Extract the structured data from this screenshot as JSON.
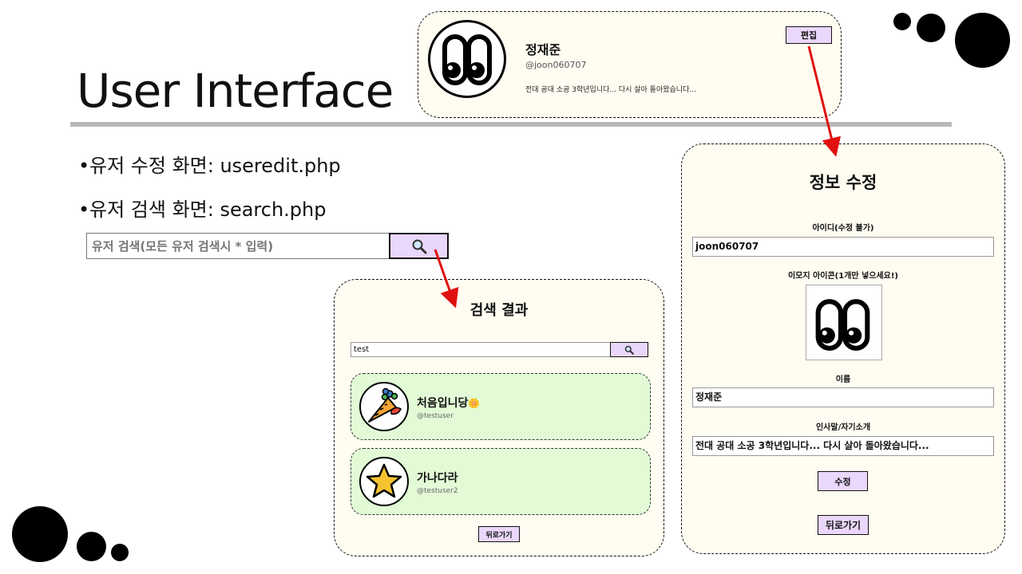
{
  "slide": {
    "title": "User Interface",
    "bullets": [
      "유저 수정 화면: useredit.php",
      "유저 검색 화면: search.php"
    ]
  },
  "top_search": {
    "placeholder": "유저 검색(모든 유저 검색시 * 입력)",
    "button_icon": "magnifier-icon"
  },
  "profile": {
    "name": "정재준",
    "handle": "@joon060707",
    "bio": "전대 공대 소공 3학년입니다... 다시 살아 돌아왔습니다...",
    "edit_label": "편집",
    "avatar_icon": "eyes-emoji-icon"
  },
  "search_results": {
    "title": "검색 결과",
    "query": "test",
    "results": [
      {
        "name": "처음입니당",
        "name_emoji": "🌼",
        "handle": "@testuser",
        "avatar_icon": "carrot-emoji-icon"
      },
      {
        "name": "가나다라",
        "name_emoji": "",
        "handle": "@testuser2",
        "avatar_icon": "star-emoji-icon"
      }
    ],
    "back_label": "뒤로가기"
  },
  "edit": {
    "title": "정보 수정",
    "id_label": "아이디(수정 불가)",
    "id_value": "joon060707",
    "emoji_label": "이모지 아이콘(1개만 넣으세요!)",
    "emoji_icon": "eyes-emoji-icon",
    "name_label": "이름",
    "name_value": "정재준",
    "bio_label": "인사말/자기소개",
    "bio_value": "전대 공대 소공 3학년입니다... 다시 살아 돌아왔습니다...",
    "submit_label": "수정",
    "back_label": "뒤로가기"
  },
  "colors": {
    "accent_button": "#ead7fb",
    "panel_bg": "#fffcf1",
    "result_bg": "#e2fbd6",
    "arrow": "#e01010"
  }
}
